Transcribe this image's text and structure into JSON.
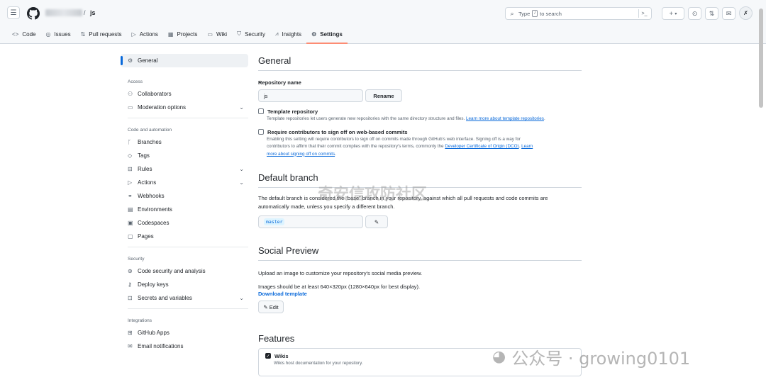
{
  "header": {
    "repo_name": "js",
    "slash": "/",
    "search_placeholder_prefix": "Type",
    "search_key": "/",
    "search_placeholder_suffix": "to search",
    "plus_label": "+",
    "caret": "▾"
  },
  "tabs": [
    {
      "label": "Code",
      "icon": "<>"
    },
    {
      "label": "Issues",
      "icon": "◎"
    },
    {
      "label": "Pull requests",
      "icon": "⇅"
    },
    {
      "label": "Actions",
      "icon": "▷"
    },
    {
      "label": "Projects",
      "icon": "▦"
    },
    {
      "label": "Wiki",
      "icon": "▭"
    },
    {
      "label": "Security",
      "icon": "⛉"
    },
    {
      "label": "Insights",
      "icon": "⩘"
    },
    {
      "label": "Settings",
      "icon": "⚙"
    }
  ],
  "sidebar": {
    "general": "General",
    "sections": {
      "access": "Access",
      "code_automation": "Code and automation",
      "security": "Security",
      "integrations": "Integrations"
    },
    "access_items": [
      "Collaborators",
      "Moderation options"
    ],
    "code_items": [
      "Branches",
      "Tags",
      "Rules",
      "Actions",
      "Webhooks",
      "Environments",
      "Codespaces",
      "Pages"
    ],
    "security_items": [
      "Code security and analysis",
      "Deploy keys",
      "Secrets and variables"
    ],
    "integration_items": [
      "GitHub Apps",
      "Email notifications"
    ]
  },
  "general": {
    "title": "General",
    "repo_name_label": "Repository name",
    "repo_name_value": "js",
    "rename_button": "Rename",
    "template_title": "Template repository",
    "template_desc": "Template repositories let users generate new repositories with the same directory structure and files.",
    "template_link": "Learn more about template repositories",
    "signoff_title": "Require contributors to sign off on web-based commits",
    "signoff_desc_1": "Enabling this setting will require contributors to sign off on commits made through GitHub's web interface. Signing off is a way for",
    "signoff_desc_2": "contributors to affirm that their commit complies with the repository's terms, commonly the",
    "signoff_dco_link": "Developer Certificate of Origin (DCO)",
    "signoff_link_a": "Learn",
    "signoff_link_b": "more about signing off on commits"
  },
  "default_branch": {
    "title": "Default branch",
    "desc_1": "The default branch is considered the “base” branch in your repository, against which all pull requests and code commits are",
    "desc_2": "automatically made, unless you specify a different branch.",
    "branch": "master"
  },
  "social_preview": {
    "title": "Social Preview",
    "desc": "Upload an image to customize your repository's social media preview.",
    "size_note": "Images should be at least 640×320px (1280×640px for best display).",
    "download_link": "Download template",
    "edit_button": "Edit"
  },
  "features": {
    "title": "Features",
    "wikis": "Wikis",
    "wikis_desc": "Wikis host documentation for your repository."
  },
  "watermarks": {
    "center": "奇安信攻防社区",
    "bottom": "公众号 · growing0101"
  }
}
